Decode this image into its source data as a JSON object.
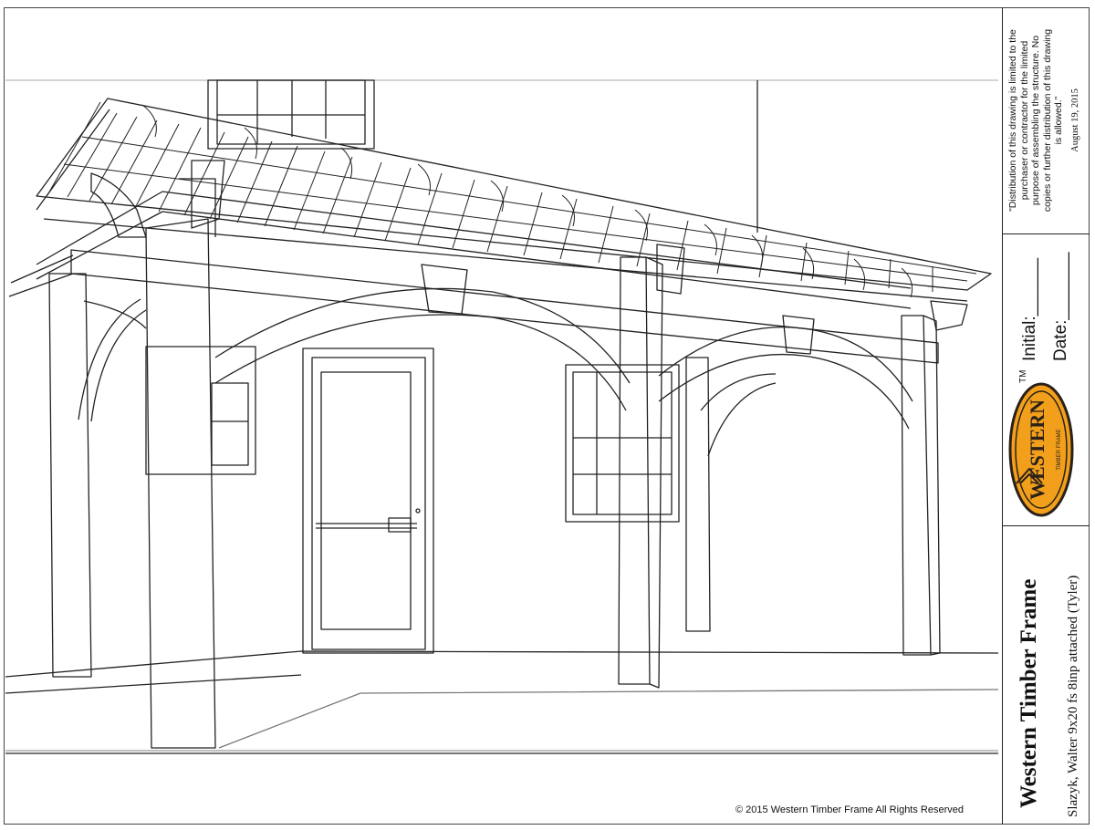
{
  "copyright": "© 2015 Western Timber Frame All Rights Reserved",
  "title_block": {
    "disclaimer_lines": [
      "\"Distribution of this drawing is limited to the",
      "purchaser or contractor for the limited",
      "purpose of assembling the structure.  No",
      "copies or further distribution of this drawing",
      "is allowed.\""
    ],
    "date": "August 19, 2015",
    "initial_label": "Initial:______",
    "date_label": "Date:_______",
    "trademark": "TM",
    "logo_text": "WESTERN",
    "logo_subtext": "TIMBER FRAME",
    "company_name": "Western Timber Frame",
    "project_name": "Slazyk, Walter 9x20 fs 8inp attached (Tyler)"
  },
  "colors": {
    "line": "#222222",
    "logo_fill": "#f2a01c",
    "logo_ink": "#2b2118"
  }
}
